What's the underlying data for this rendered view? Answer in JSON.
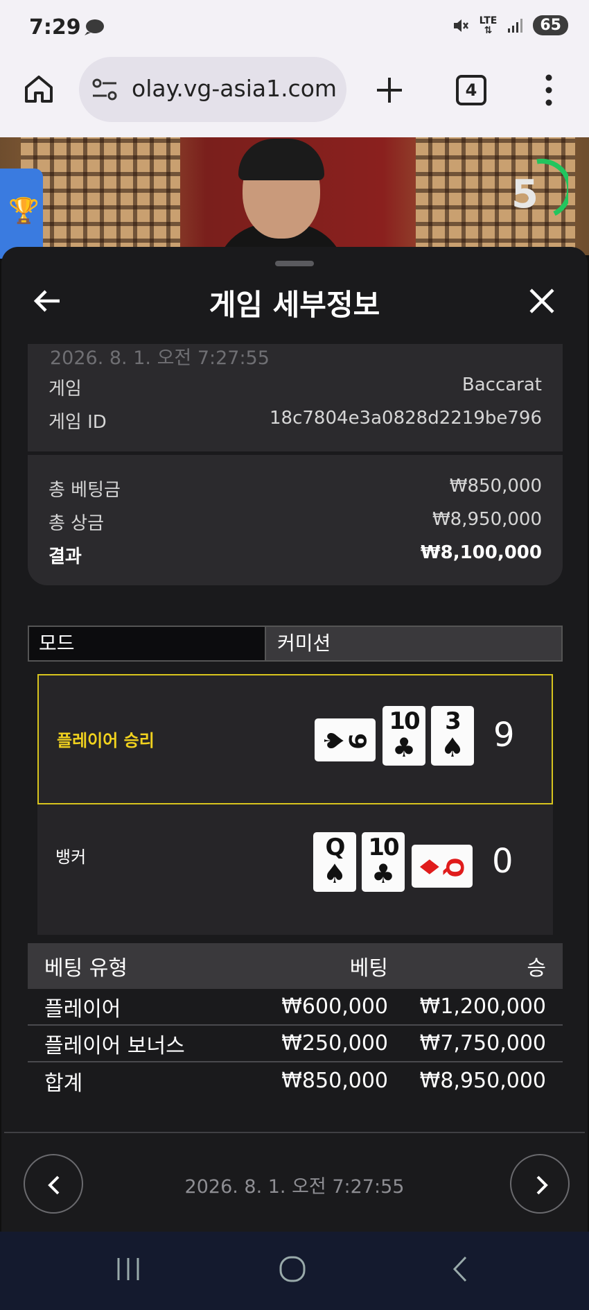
{
  "status": {
    "time": "7:29",
    "lte": "LTE",
    "battery": "65"
  },
  "browser": {
    "url": "olay.vg-asia1.com",
    "tab_count": "4"
  },
  "video": {
    "countdown": "5"
  },
  "sheet": {
    "title": "게임 세부정보",
    "date_top": "2026. 8. 1. 오전 7:27:55",
    "game_label": "게임",
    "game_value": "Baccarat",
    "game_id_label": "게임 ID",
    "game_id_value": "18c7804e3a0828d2219be796",
    "total_bet_label": "총 베팅금",
    "total_bet_value": "₩850,000",
    "total_prize_label": "총 상금",
    "total_prize_value": "₩8,950,000",
    "result_label": "결과",
    "result_value": "₩8,100,000"
  },
  "mode": {
    "left": "모드",
    "right": "커미션"
  },
  "hands": {
    "player": {
      "label": "플레이어 승리",
      "score": "9",
      "cards": [
        {
          "rank": "9",
          "suit": "♠",
          "color": "#111111",
          "sideways": true
        },
        {
          "rank": "10",
          "suit": "♣",
          "color": "#111111",
          "sideways": false
        },
        {
          "rank": "3",
          "suit": "♠",
          "color": "#111111",
          "sideways": false
        }
      ]
    },
    "banker": {
      "label": "뱅커",
      "score": "0",
      "cards": [
        {
          "rank": "Q",
          "suit": "♠",
          "color": "#111111",
          "sideways": false
        },
        {
          "rank": "10",
          "suit": "♣",
          "color": "#111111",
          "sideways": false
        },
        {
          "rank": "Q",
          "suit": "♦",
          "color": "#e01c1c",
          "sideways": true
        }
      ]
    }
  },
  "bets": {
    "headers": [
      "베팅 유형",
      "베팅",
      "승"
    ],
    "rows": [
      [
        "플레이어",
        "₩600,000",
        "₩1,200,000"
      ],
      [
        "플레이어 보너스",
        "₩250,000",
        "₩7,750,000"
      ],
      [
        "합계",
        "₩850,000",
        "₩8,950,000"
      ]
    ]
  },
  "footer": {
    "date": "2026. 8. 1. 오전 7:27:55"
  },
  "colors": {
    "win_border": "#d8c51e",
    "win_text": "#f1d21e",
    "sheet_bg": "#1a1a1c"
  }
}
